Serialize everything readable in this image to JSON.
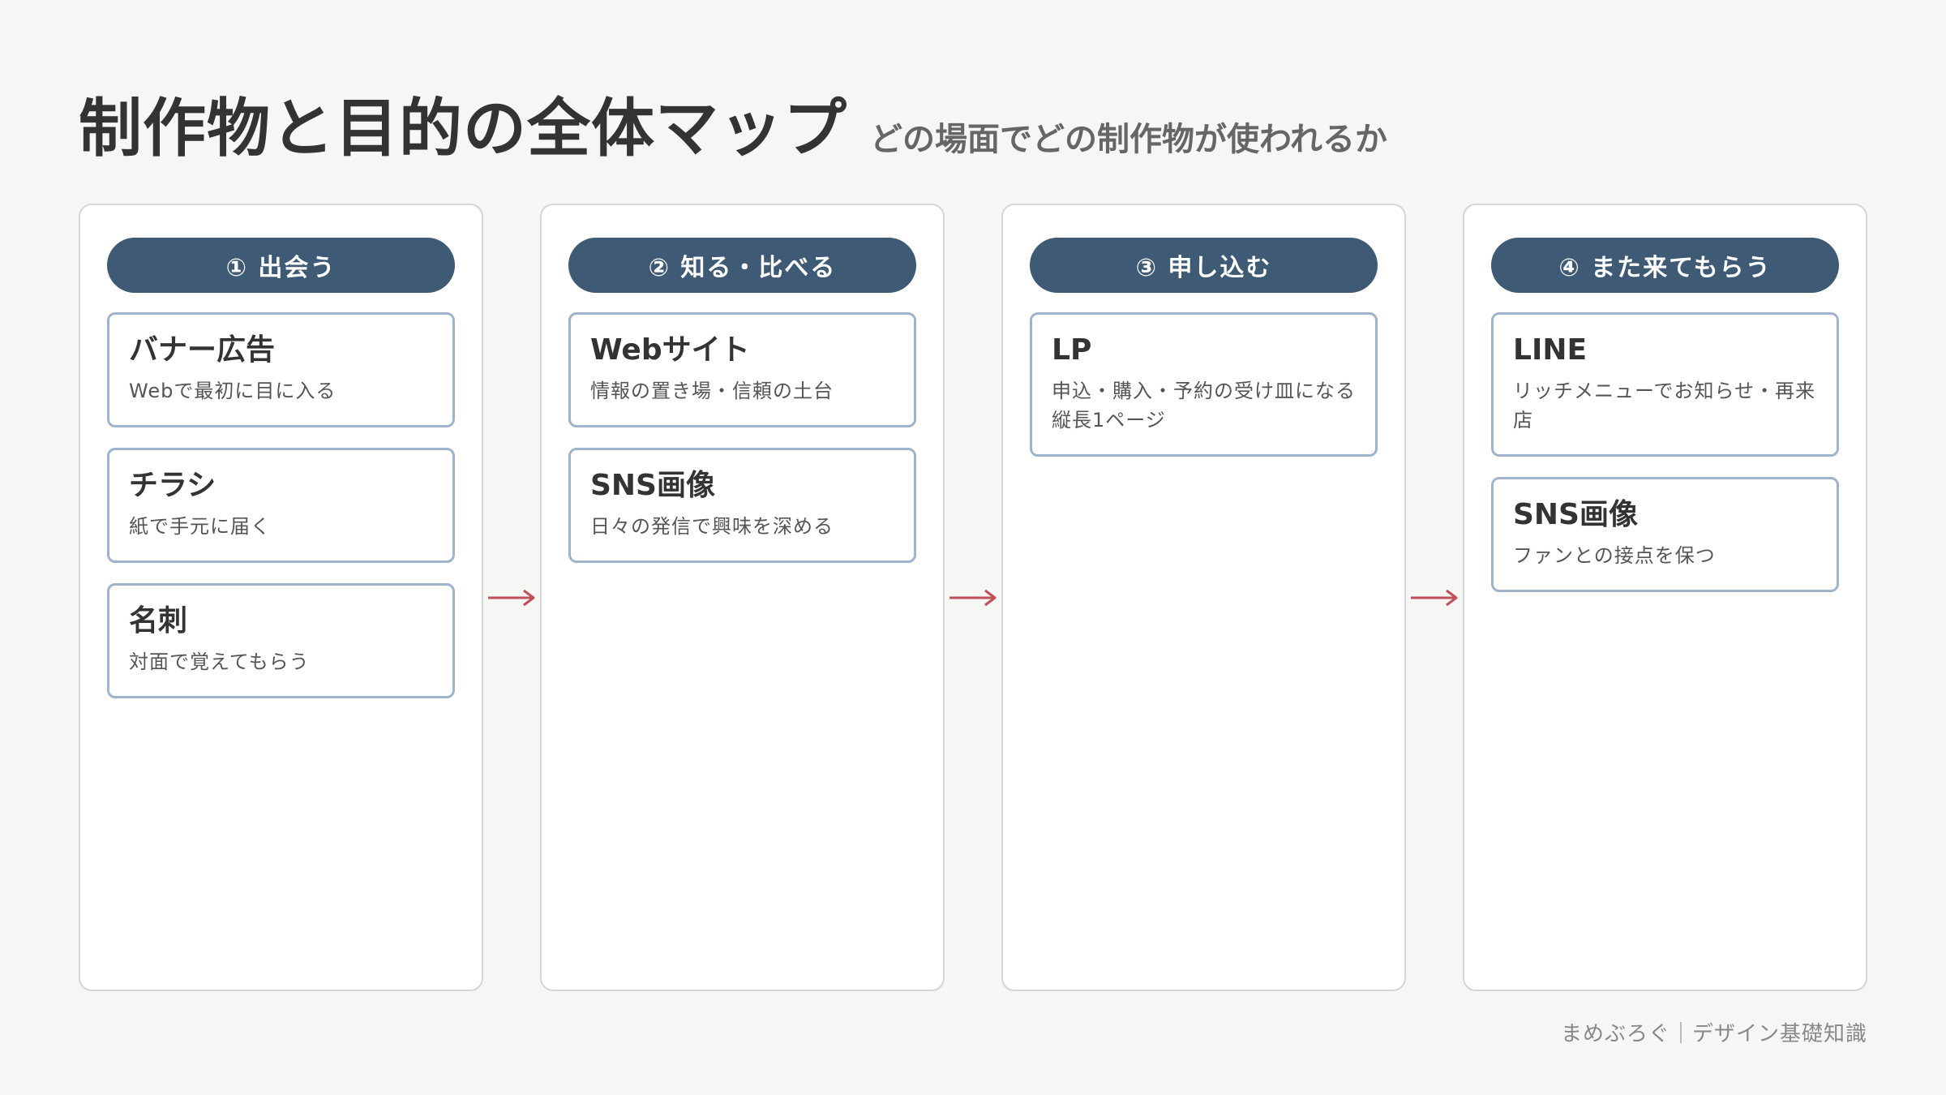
{
  "header": {
    "title": "制作物と目的の全体マップ",
    "subtitle": "どの場面でどの制作物が使われるか"
  },
  "stages": [
    {
      "label": "① 出会う",
      "cards": [
        {
          "title": "バナー広告",
          "desc": "Webで最初に目に入る"
        },
        {
          "title": "チラシ",
          "desc": "紙で手元に届く"
        },
        {
          "title": "名刺",
          "desc": "対面で覚えてもらう"
        }
      ]
    },
    {
      "label": "② 知る・比べる",
      "cards": [
        {
          "title": "Webサイト",
          "desc": "情報の置き場・信頼の土台"
        },
        {
          "title": "SNS画像",
          "desc": "日々の発信で興味を深める"
        }
      ]
    },
    {
      "label": "③ 申し込む",
      "cards": [
        {
          "title": "LP",
          "desc": "申込・購入・予約の受け皿になる縦長1ページ"
        }
      ]
    },
    {
      "label": "④ また来てもらう",
      "cards": [
        {
          "title": "LINE",
          "desc": "リッチメニューでお知らせ・再来店"
        },
        {
          "title": "SNS画像",
          "desc": "ファンとの接点を保つ"
        }
      ]
    }
  ],
  "footer": {
    "text": "まめぶろぐ｜デザイン基礎知識"
  },
  "colors": {
    "pill": "#3e5a74",
    "card_border": "#9fb4cc",
    "arrow": "#c0505a"
  }
}
